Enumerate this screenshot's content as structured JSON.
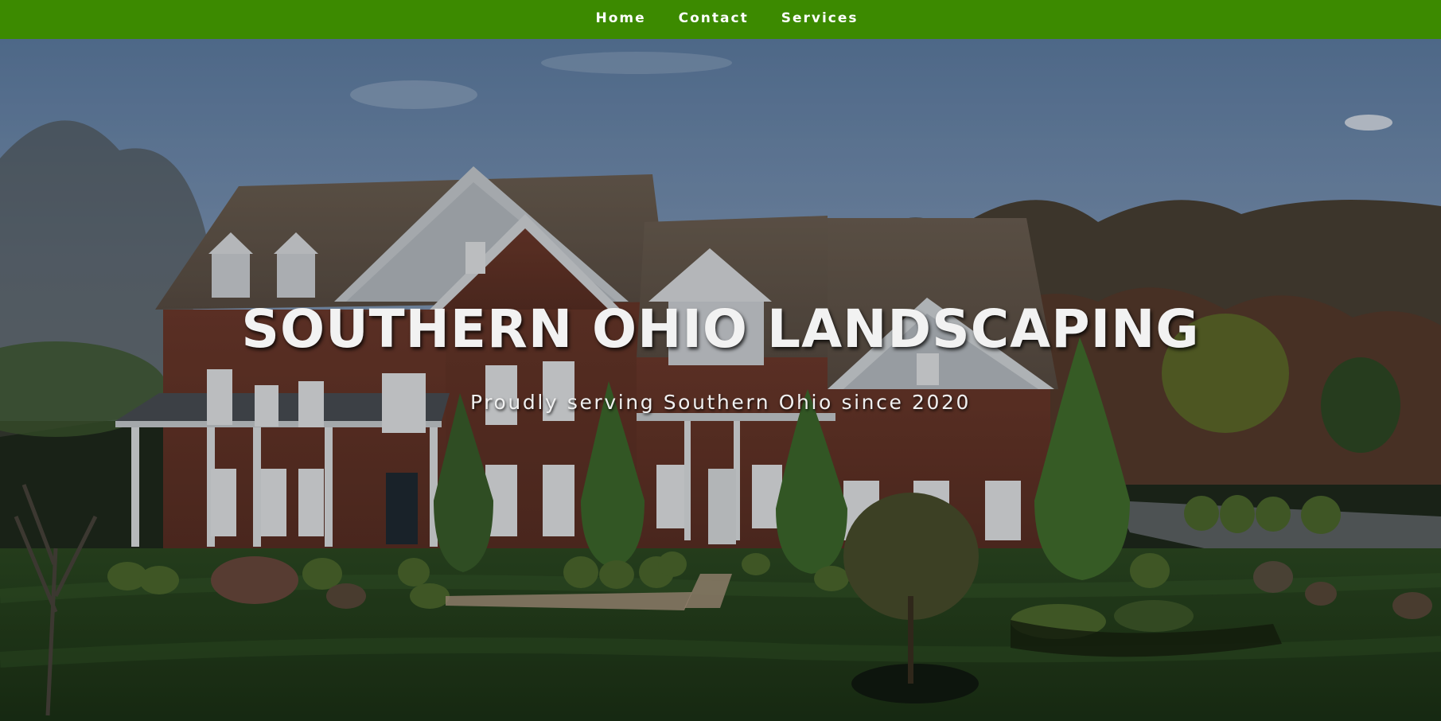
{
  "nav": {
    "links": [
      {
        "label": "Home"
      },
      {
        "label": "Contact"
      },
      {
        "label": "Services"
      }
    ],
    "background_color": "#3c8a00"
  },
  "hero": {
    "title": "SOUTHERN OHIO LANDSCAPING",
    "subtitle": "Proudly serving Southern Ohio since 2020",
    "background_description_icon": "house-photo"
  }
}
